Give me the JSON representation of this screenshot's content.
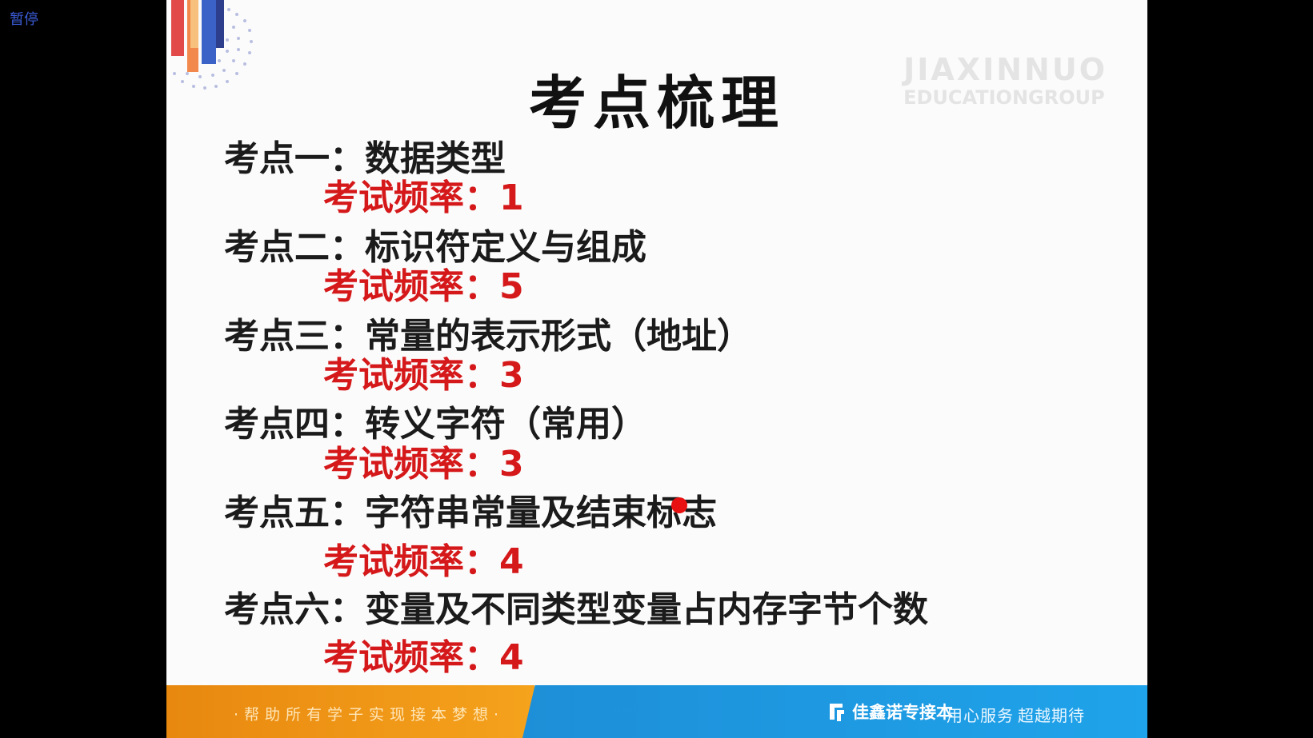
{
  "player": {
    "pause_label": "暂停"
  },
  "slide": {
    "title": "考点梳理",
    "watermark": {
      "line1": "JIAXINNUO",
      "line2": "EDUCATIONGROUP"
    },
    "points": [
      {
        "label": "考点一：数据类型",
        "frequency": "考试频率：1"
      },
      {
        "label": "考点二：标识符定义与组成",
        "frequency": "考试频率：5"
      },
      {
        "label": "考点三：常量的表示形式（地址）",
        "frequency": "考试频率：3"
      },
      {
        "label": "考点四：转义字符（常用）",
        "frequency": "考试频率：3"
      },
      {
        "label": "考点五：字符串常量及结束标志",
        "frequency": "考试频率：4"
      },
      {
        "label": "考点六：变量及不同类型变量占内存字节个数",
        "frequency": "考试频率：4"
      }
    ],
    "footer": {
      "slogan": "·帮助所有学子实现接本梦想·",
      "brand": "佳鑫诺专接本",
      "tagline_1": "用心服务",
      "tagline_2": "超越期待"
    }
  },
  "colors": {
    "accent_red": "#d5181a",
    "footer_orange": "#f5a21d",
    "footer_blue": "#1fa3ea",
    "pause_blue": "#3b5bd6"
  },
  "icons": {
    "deco": "corner-decoration-icon",
    "brand": "brand-logo-icon"
  }
}
